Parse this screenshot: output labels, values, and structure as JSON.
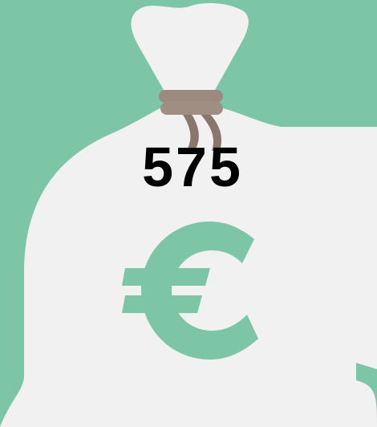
{
  "amount": "575",
  "currency_symbol": "€",
  "icons": {
    "bag": "money-bag-icon",
    "currency": "euro-icon"
  },
  "colors": {
    "background": "#7dc5a7",
    "bag": "#f1f1f1",
    "tie": "#9d8a7f",
    "tie_dark": "#8a776b",
    "symbol": "#7dc5a7",
    "text": "#000000"
  }
}
